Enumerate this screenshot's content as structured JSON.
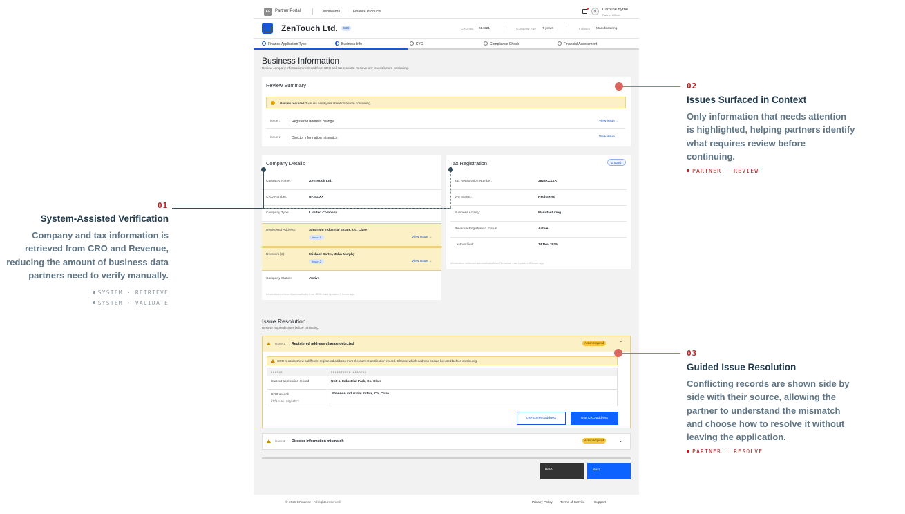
{
  "topbar": {
    "logo": "EF",
    "portal": "Partner Portal",
    "nav": [
      "Dashboard#1",
      "Finance Products"
    ],
    "user_name": "Caroline Byrne",
    "user_role": "Partner Officer"
  },
  "company": {
    "name": "ZenTouch Ltd.",
    "badge": "B2B",
    "cro_label": "CRO No.",
    "cro_value": "654321",
    "age_label": "Company Age",
    "age_value": "7 years",
    "industry_label": "Industry",
    "industry_value": "Manufacturing"
  },
  "steps": {
    "items": [
      "Finance Application Type",
      "Business Info",
      "KYC",
      "Compliance Check",
      "Financial Assessment"
    ],
    "progress": 0.4
  },
  "page": {
    "title": "Business Information",
    "subtitle": "Review company information retrieved from CRO and tax records. Resolve any issues before continuing."
  },
  "review": {
    "title": "Review Summary",
    "alert_strong": "Review required",
    "alert_text": "2 issues need your attention before continuing.",
    "issues": [
      {
        "num": "Issue 1",
        "desc": "Registered address change",
        "link": "View issue →"
      },
      {
        "num": "Issue 2",
        "desc": "Director information mismatch",
        "link": "View issue →"
      }
    ]
  },
  "company_details": {
    "title": "Company Details",
    "rows": [
      {
        "label": "Company Name:",
        "value": "ZenTouch Ltd."
      },
      {
        "label": "CRO Number:",
        "value": "6724XXX"
      },
      {
        "label": "Company Type:",
        "value": "Limited Company"
      },
      {
        "label": "Registered Address:",
        "value": "Shannon Industrial Estate, Co. Clare",
        "tag": "Issue 1",
        "link": "View Issue →"
      },
      {
        "label": "Directors (2):",
        "value": "Michael Carter, John Murphy",
        "tag": "Issue 2",
        "link": "View Issue →"
      },
      {
        "label": "Company Status:",
        "value": "Active"
      }
    ],
    "footer": "Information retrieved automatically from CRO. Last updated 2 hours ago."
  },
  "tax": {
    "title": "Tax Registration",
    "match": "Match",
    "rows": [
      {
        "label": "Tax Registration Number:",
        "value": "3825XXXXA"
      },
      {
        "label": "VAT Status:",
        "value": "Registered"
      },
      {
        "label": "Business Activity:",
        "value": "Manufacturing"
      },
      {
        "label": "Revenue Registration Status:",
        "value": "Active"
      },
      {
        "label": "Last Verified:",
        "value": "14 Nov 2025"
      }
    ],
    "footer": "Information retrieved automatically from Revenue. Last updated 2 hours ago."
  },
  "resolution": {
    "title": "Issue Resolution",
    "subtitle": "Resolve required issues before continuing.",
    "issue1": {
      "num": "Issue 1",
      "title": "Registered address change detected",
      "status": "Action required",
      "alert": "CRO records show a different registered address from the current application record. Choose which address should be used before continuing.",
      "col_source": "SOURCE",
      "col_address": "REGISTERED ADDRESS",
      "row1_source": "Current application record",
      "row1_address": "Unit 5, Industrial Park, Co. Clare",
      "row2_source": "CRO record",
      "row2_sub": "Official registry",
      "row2_address": "Shannon Industrial Estate, Co. Clare",
      "btn_current": "Use current address",
      "btn_cro": "Use CRO address"
    },
    "issue2": {
      "num": "Issue 2",
      "title": "Director information mismatch",
      "status": "Action required"
    }
  },
  "nav_buttons": {
    "back": "Back",
    "next": "Next"
  },
  "footer": {
    "copyright": "© 2025 EFinance · All rights reserved.",
    "links": [
      "Privacy Policy",
      "Terms of Service",
      "Support"
    ]
  },
  "annotations": {
    "a01": {
      "num": "01",
      "title": "System-Assisted Verification",
      "body": "Company and tax information is retrieved from CRO and Revenue, reducing the amount of business data partners need to verify manually.",
      "tags": [
        "SYSTEM · RETRIEVE",
        "SYSTEM · VALIDATE"
      ]
    },
    "a02": {
      "num": "02",
      "title": "Issues Surfaced in Context",
      "body": "Only information that needs attention is highlighted, helping partners identify what requires review before continuing.",
      "tags": [
        "PARTNER · REVIEW"
      ]
    },
    "a03": {
      "num": "03",
      "title": "Guided Issue Resolution",
      "body": "Conflicting records are shown side by side with their source, allowing the partner to understand the mismatch and choose how to resolve it without leaving the application.",
      "tags": [
        "PARTNER · RESOLVE"
      ]
    }
  },
  "colors": {
    "accent": "#1a56db",
    "primary_button": "#0d63ff",
    "warning_bg": "#fbf0c6",
    "annotation_red": "#b22222",
    "annotation_title": "#1f3a4d"
  }
}
